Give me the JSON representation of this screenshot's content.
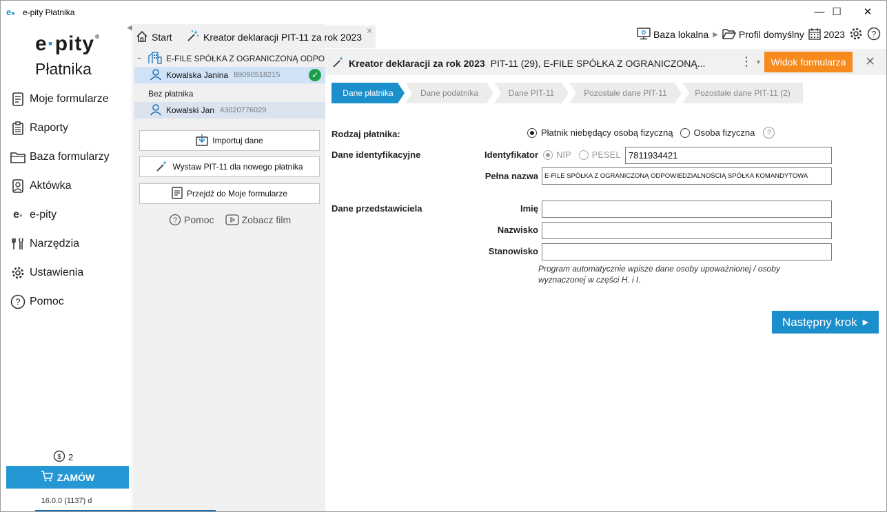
{
  "window": {
    "title": "e-pity Płatnika",
    "minimize": "—",
    "maximize": "☐",
    "close": "✕"
  },
  "logo": {
    "top_pre": "e",
    "top_dot": "·",
    "top_post": "pity",
    "reg": "®",
    "bottom": "Płatnika"
  },
  "sidebar": {
    "items": [
      {
        "label": "Moje formularze",
        "icon": "document-icon"
      },
      {
        "label": "Raporty",
        "icon": "clipboard-icon"
      },
      {
        "label": "Baza formularzy",
        "icon": "folder-icon"
      },
      {
        "label": "Aktówka",
        "icon": "briefcase-icon"
      },
      {
        "label": "e-pity",
        "icon": "epity-icon"
      },
      {
        "label": "Narzędzia",
        "icon": "tools-icon"
      },
      {
        "label": "Ustawienia",
        "icon": "gear-icon"
      },
      {
        "label": "Pomoc",
        "icon": "help-icon"
      }
    ],
    "coins_count": "2",
    "order_label": "ZAMÓW",
    "version": "16.0.0 (1137) d"
  },
  "tabs": {
    "start": "Start",
    "kreator": "Kreator deklaracji PIT-11 za rok 2023"
  },
  "toolbar": {
    "baza": "Baza lokalna",
    "profil": "Profil domyślny",
    "year": "2023"
  },
  "tree": {
    "company": "E-FILE SPÓŁKA Z OGRANICZONĄ ODPO",
    "person1_name": "Kowalska Janina",
    "person1_id": "89090518215",
    "group": "Bez płatnika",
    "person2_name": "Kowalski Jan",
    "person2_id": "43020776029"
  },
  "actions": {
    "import": "Importuj dane",
    "wystaw": "Wystaw PIT-11 dla nowego płatnika",
    "przejdz": "Przejdź do Moje formularze",
    "pomoc": "Pomoc",
    "film": "Zobacz film"
  },
  "main": {
    "title_bold": "Kreator deklaracji za rok 2023",
    "title_rest": "PIT-11 (29), E-FILE SPÓŁKA Z OGRANICZONĄ...",
    "widok": "Widok formularza"
  },
  "steps": [
    {
      "label": "Dane płatnika",
      "active": true
    },
    {
      "label": "Dane podatnika",
      "active": false
    },
    {
      "label": "Dane PIT-11",
      "active": false
    },
    {
      "label": "Pozostałe dane PIT-11",
      "active": false
    },
    {
      "label": "Pozostałe dane PIT-11 (2)",
      "active": false
    }
  ],
  "form": {
    "rodzaj_label": "Rodzaj płatnika:",
    "opt_nonphysical": "Płatnik niebędący osobą fizyczną",
    "opt_physical": "Osoba fizyczna",
    "dane_ident": "Dane identyfikacyjne",
    "identyfikator": "Identyfikator",
    "nip": "NIP",
    "pesel": "PESEL",
    "id_value": "7811934421",
    "pelna_nazwa": "Pełna nazwa",
    "pelna_value": "E-FILE SPÓŁKA Z OGRANICZONĄ ODPOWIEDZIALNOŚCIĄ SPÓŁKA KOMANDYTOWA",
    "dane_przed": "Dane przedstawiciela",
    "imie": "Imię",
    "nazwisko": "Nazwisko",
    "stanowisko": "Stanowisko",
    "hint": "Program automatycznie wpisze dane osoby upoważnionej / osoby wyznaczonej w części H. i I.",
    "next": "Następny krok"
  },
  "colors": {
    "accent": "#1b8ecc",
    "orange": "#f78a1d",
    "success": "#1ea04a"
  }
}
